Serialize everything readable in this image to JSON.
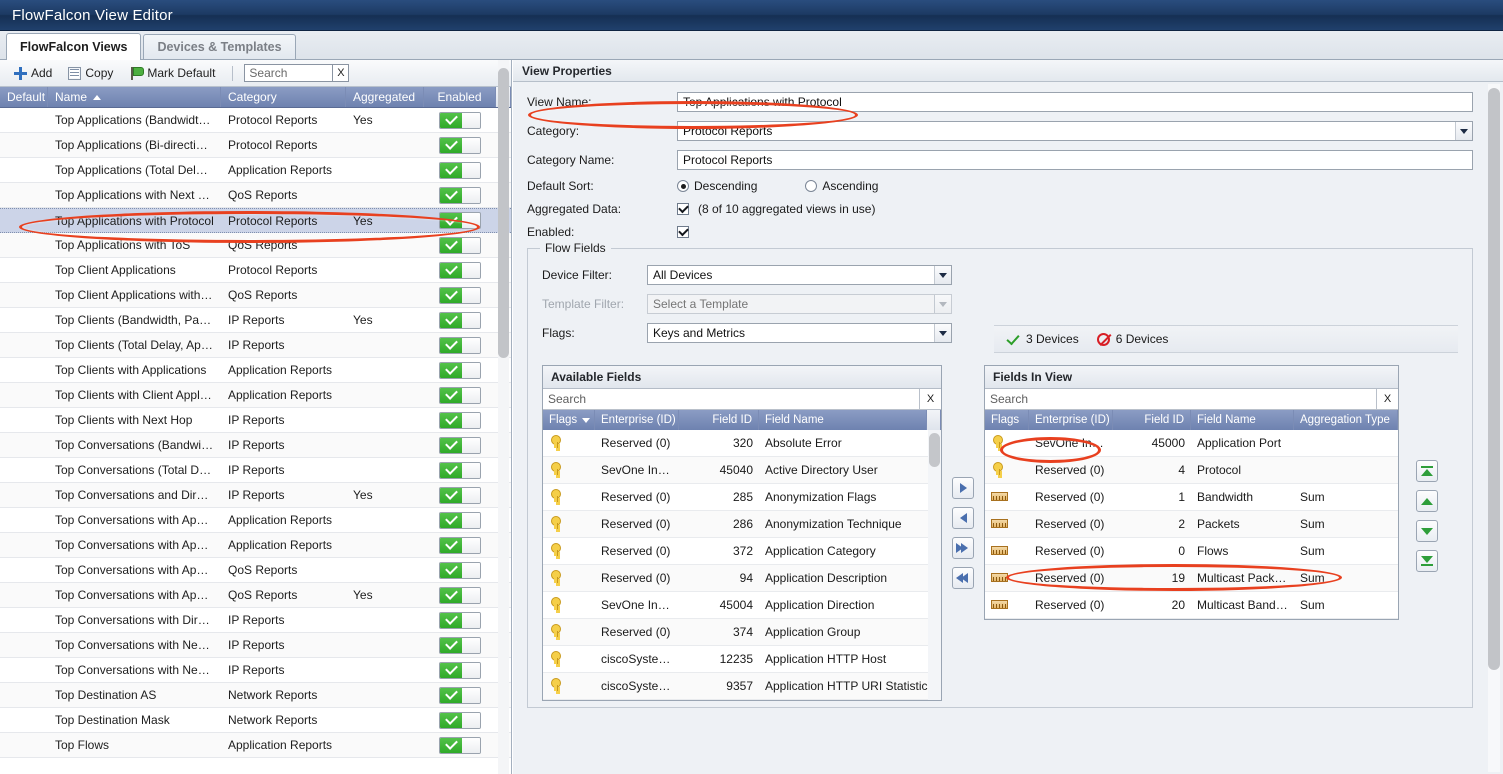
{
  "window": {
    "title": "FlowFalcon View Editor"
  },
  "tabs": [
    {
      "label": "FlowFalcon Views",
      "active": true
    },
    {
      "label": "Devices & Templates",
      "active": false
    }
  ],
  "left_toolbar": {
    "add_label": "Add",
    "copy_label": "Copy",
    "mark_default_label": "Mark Default",
    "search_value": "",
    "search_placeholder": "Search",
    "clear_label": "X"
  },
  "views_grid": {
    "columns": [
      "Default",
      "Name",
      "Category",
      "Aggregated",
      "Enabled"
    ],
    "sort_column": "Name",
    "sort_dir": "asc",
    "rows": [
      {
        "name": "Top Applications (Bandwidth, P...",
        "category": "Protocol Reports",
        "aggregated": "Yes",
        "enabled": true,
        "selected": false
      },
      {
        "name": "Top Applications (Bi-directional)",
        "category": "Protocol Reports",
        "aggregated": "",
        "enabled": true,
        "selected": false
      },
      {
        "name": "Top Applications (Total Delay, ...",
        "category": "Application Reports",
        "aggregated": "",
        "enabled": true,
        "selected": false
      },
      {
        "name": "Top Applications with Next Ho...",
        "category": "QoS Reports",
        "aggregated": "",
        "enabled": true,
        "selected": false
      },
      {
        "name": "Top Applications with Protocol",
        "category": "Protocol Reports",
        "aggregated": "Yes",
        "enabled": true,
        "selected": true
      },
      {
        "name": "Top Applications with ToS",
        "category": "QoS Reports",
        "aggregated": "",
        "enabled": true,
        "selected": false
      },
      {
        "name": "Top Client Applications",
        "category": "Protocol Reports",
        "aggregated": "",
        "enabled": true,
        "selected": false
      },
      {
        "name": "Top Client Applications with ToS",
        "category": "QoS Reports",
        "aggregated": "",
        "enabled": true,
        "selected": false
      },
      {
        "name": "Top Clients (Bandwidth, Packet...",
        "category": "IP Reports",
        "aggregated": "Yes",
        "enabled": true,
        "selected": false
      },
      {
        "name": "Top Clients (Total Delay, Applic...",
        "category": "IP Reports",
        "aggregated": "",
        "enabled": true,
        "selected": false
      },
      {
        "name": "Top Clients with Applications",
        "category": "Application Reports",
        "aggregated": "",
        "enabled": true,
        "selected": false
      },
      {
        "name": "Top Clients with Client Applicat...",
        "category": "Application Reports",
        "aggregated": "",
        "enabled": true,
        "selected": false
      },
      {
        "name": "Top Clients with Next Hop",
        "category": "IP Reports",
        "aggregated": "",
        "enabled": true,
        "selected": false
      },
      {
        "name": "Top Conversations (Bandwidth,...",
        "category": "IP Reports",
        "aggregated": "",
        "enabled": true,
        "selected": false
      },
      {
        "name": "Top Conversations (Total Delay...",
        "category": "IP Reports",
        "aggregated": "",
        "enabled": true,
        "selected": false
      },
      {
        "name": "Top Conversations and Direction",
        "category": "IP Reports",
        "aggregated": "Yes",
        "enabled": true,
        "selected": false
      },
      {
        "name": "Top Conversations with Applica...",
        "category": "Application Reports",
        "aggregated": "",
        "enabled": true,
        "selected": false
      },
      {
        "name": "Top Conversations with Applica...",
        "category": "Application Reports",
        "aggregated": "",
        "enabled": true,
        "selected": false
      },
      {
        "name": "Top Conversations with Applica...",
        "category": "QoS Reports",
        "aggregated": "",
        "enabled": true,
        "selected": false
      },
      {
        "name": "Top Conversations with Applica...",
        "category": "QoS Reports",
        "aggregated": "Yes",
        "enabled": true,
        "selected": false
      },
      {
        "name": "Top Conversations with Direction",
        "category": "IP Reports",
        "aggregated": "",
        "enabled": true,
        "selected": false
      },
      {
        "name": "Top Conversations with Next H...",
        "category": "IP Reports",
        "aggregated": "",
        "enabled": true,
        "selected": false
      },
      {
        "name": "Top Conversations with Next H...",
        "category": "IP Reports",
        "aggregated": "",
        "enabled": true,
        "selected": false
      },
      {
        "name": "Top Destination AS",
        "category": "Network Reports",
        "aggregated": "",
        "enabled": true,
        "selected": false
      },
      {
        "name": "Top Destination Mask",
        "category": "Network Reports",
        "aggregated": "",
        "enabled": true,
        "selected": false
      },
      {
        "name": "Top Flows",
        "category": "Application Reports",
        "aggregated": "",
        "enabled": true,
        "selected": false
      }
    ]
  },
  "properties": {
    "panel_title": "View Properties",
    "view_name_label": "View Name:",
    "view_name_value": "Top Applications with Protocol",
    "category_label": "Category:",
    "category_value": "Protocol Reports",
    "category_name_label": "Category Name:",
    "category_name_value": "Protocol Reports",
    "default_sort_label": "Default Sort:",
    "sort_descending_label": "Descending",
    "sort_ascending_label": "Ascending",
    "sort_selected": "Descending",
    "aggregated_data_label": "Aggregated Data:",
    "aggregated_data_checked": true,
    "aggregated_hint": "(8 of 10 aggregated views in use)",
    "enabled_label": "Enabled:",
    "enabled_checked": true
  },
  "flow_fields": {
    "legend": "Flow Fields",
    "device_filter_label": "Device Filter:",
    "device_filter_value": "All Devices",
    "template_filter_label": "Template Filter:",
    "template_filter_placeholder": "Select a Template",
    "template_filter_disabled": true,
    "flags_label": "Flags:",
    "flags_value": "Keys and Metrics",
    "device_status": {
      "allowed_count": "3 Devices",
      "blocked_count": "6 Devices"
    },
    "available": {
      "caption": "Available Fields",
      "search_value": "",
      "search_placeholder": "Search",
      "clear_label": "X",
      "columns": [
        "Flags",
        "Enterprise (ID)",
        "Field ID",
        "Field Name"
      ],
      "sort_column": "Flags",
      "rows": [
        {
          "flag": "key",
          "enterprise": "Reserved (0)",
          "field_id": "320",
          "field_name": "Absolute Error"
        },
        {
          "flag": "key",
          "enterprise": "SevOne Inc (...",
          "field_id": "45040",
          "field_name": "Active Directory User"
        },
        {
          "flag": "key",
          "enterprise": "Reserved (0)",
          "field_id": "285",
          "field_name": "Anonymization Flags"
        },
        {
          "flag": "key",
          "enterprise": "Reserved (0)",
          "field_id": "286",
          "field_name": "Anonymization Technique"
        },
        {
          "flag": "key",
          "enterprise": "Reserved (0)",
          "field_id": "372",
          "field_name": "Application Category"
        },
        {
          "flag": "key",
          "enterprise": "Reserved (0)",
          "field_id": "94",
          "field_name": "Application Description"
        },
        {
          "flag": "key",
          "enterprise": "SevOne Inc (...",
          "field_id": "45004",
          "field_name": "Application Direction"
        },
        {
          "flag": "key",
          "enterprise": "Reserved (0)",
          "field_id": "374",
          "field_name": "Application Group"
        },
        {
          "flag": "key",
          "enterprise": "ciscoSystems...",
          "field_id": "12235",
          "field_name": "Application HTTP Host"
        },
        {
          "flag": "key",
          "enterprise": "ciscoSystems...",
          "field_id": "9357",
          "field_name": "Application HTTP URI Statistics"
        }
      ]
    },
    "transfer_buttons": [
      {
        "name": "move-right",
        "glyph": "right"
      },
      {
        "name": "move-left",
        "glyph": "left"
      },
      {
        "name": "move-all-right",
        "glyph": "right-all"
      },
      {
        "name": "move-all-left",
        "glyph": "left-all"
      }
    ],
    "in_view": {
      "caption": "Fields In View",
      "search_value": "",
      "search_placeholder": "Search",
      "clear_label": "X",
      "columns": [
        "Flags",
        "Enterprise (ID)",
        "Field ID",
        "Field Name",
        "Aggregation Type"
      ],
      "rows": [
        {
          "flag": "key",
          "enterprise": "SevOne Inc ...",
          "field_id": "45000",
          "field_name": "Application Port",
          "aggregation": "",
          "highlighted": false
        },
        {
          "flag": "key",
          "enterprise": "Reserved (0)",
          "field_id": "4",
          "field_name": "Protocol",
          "aggregation": "",
          "highlighted": false
        },
        {
          "flag": "metric",
          "enterprise": "Reserved (0)",
          "field_id": "1",
          "field_name": "Bandwidth",
          "aggregation": "Sum",
          "highlighted": true
        },
        {
          "flag": "metric",
          "enterprise": "Reserved (0)",
          "field_id": "2",
          "field_name": "Packets",
          "aggregation": "Sum",
          "highlighted": false
        },
        {
          "flag": "metric",
          "enterprise": "Reserved (0)",
          "field_id": "0",
          "field_name": "Flows",
          "aggregation": "Sum",
          "highlighted": false
        },
        {
          "flag": "metric",
          "enterprise": "Reserved (0)",
          "field_id": "19",
          "field_name": "Multicast Packets",
          "aggregation": "Sum",
          "highlighted": false
        },
        {
          "flag": "metric",
          "enterprise": "Reserved (0)",
          "field_id": "20",
          "field_name": "Multicast Bandwid...",
          "aggregation": "Sum",
          "highlighted": false
        }
      ]
    },
    "order_buttons": [
      {
        "name": "move-to-top",
        "glyph": "top"
      },
      {
        "name": "move-up",
        "glyph": "up"
      },
      {
        "name": "move-down",
        "glyph": "down"
      },
      {
        "name": "move-to-bottom",
        "glyph": "bottom"
      }
    ]
  },
  "annotation_color": "#e8401f"
}
